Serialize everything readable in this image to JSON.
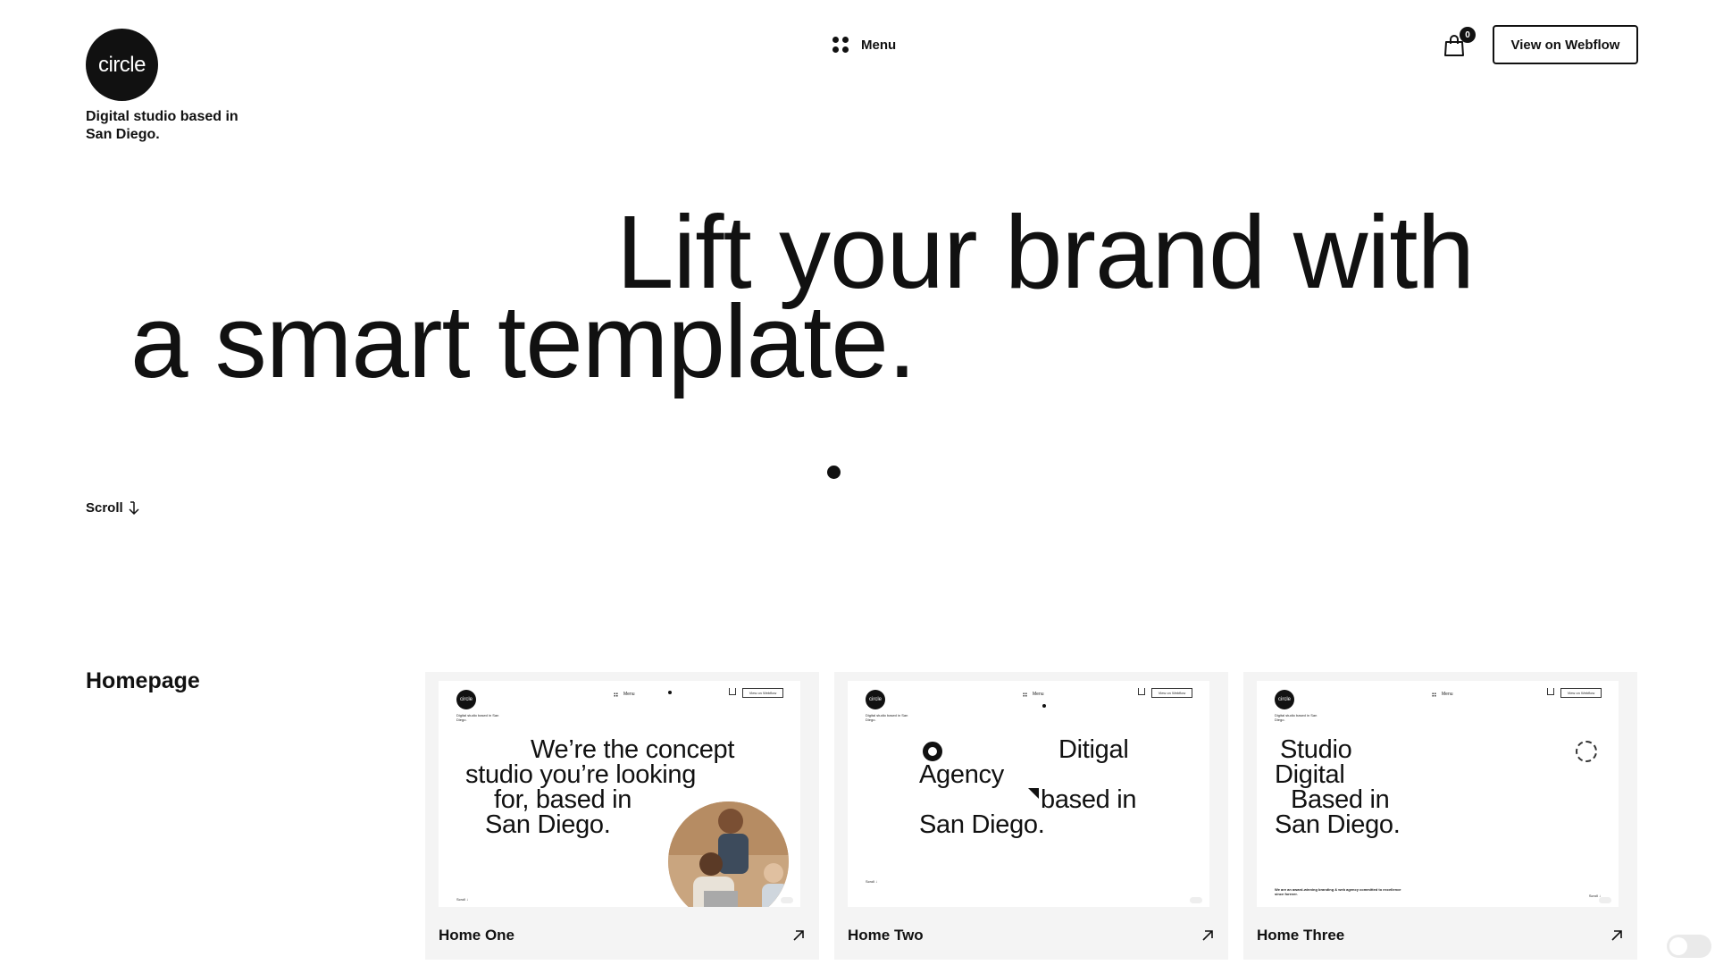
{
  "brand": {
    "logo_text": "circle",
    "tagline": "Digital studio based in San Diego."
  },
  "nav": {
    "menu_label": "Menu",
    "menu_icon": "grid-dots-icon",
    "cart_count": "0",
    "cart_icon": "shopping-bag-icon",
    "cta_label": "View on Webflow"
  },
  "hero": {
    "line1": "Lift your brand with",
    "line2": "a smart template.",
    "scroll_label": "Scroll",
    "scroll_icon": "arrow-down-icon"
  },
  "homepage": {
    "title": "Homepage",
    "cards": [
      {
        "title": "Home One",
        "thumb_lines": [
          "We’re the concept",
          "studio you’re looking",
          "for, based in",
          "San Diego."
        ]
      },
      {
        "title": "Home Two",
        "thumb_lines": [
          "Ditigal",
          "Agency",
          "based in",
          "San Diego."
        ]
      },
      {
        "title": "Home Three",
        "thumb_lines": [
          "Studio",
          "Digital",
          "Based in",
          "San Diego."
        ],
        "thumb_footer": "We are an award-winning branding & web agency committed to excellence since forever."
      }
    ]
  },
  "thumb_chrome": {
    "logo_text": "circle",
    "tagline": "Digital studio based in San Diego.",
    "menu_label": "Menu",
    "button_label": "View on Webflow",
    "scroll_label": "Scroll ↓"
  },
  "colors": {
    "text": "#111111",
    "background": "#ffffff",
    "card_bg": "#f4f4f4"
  }
}
